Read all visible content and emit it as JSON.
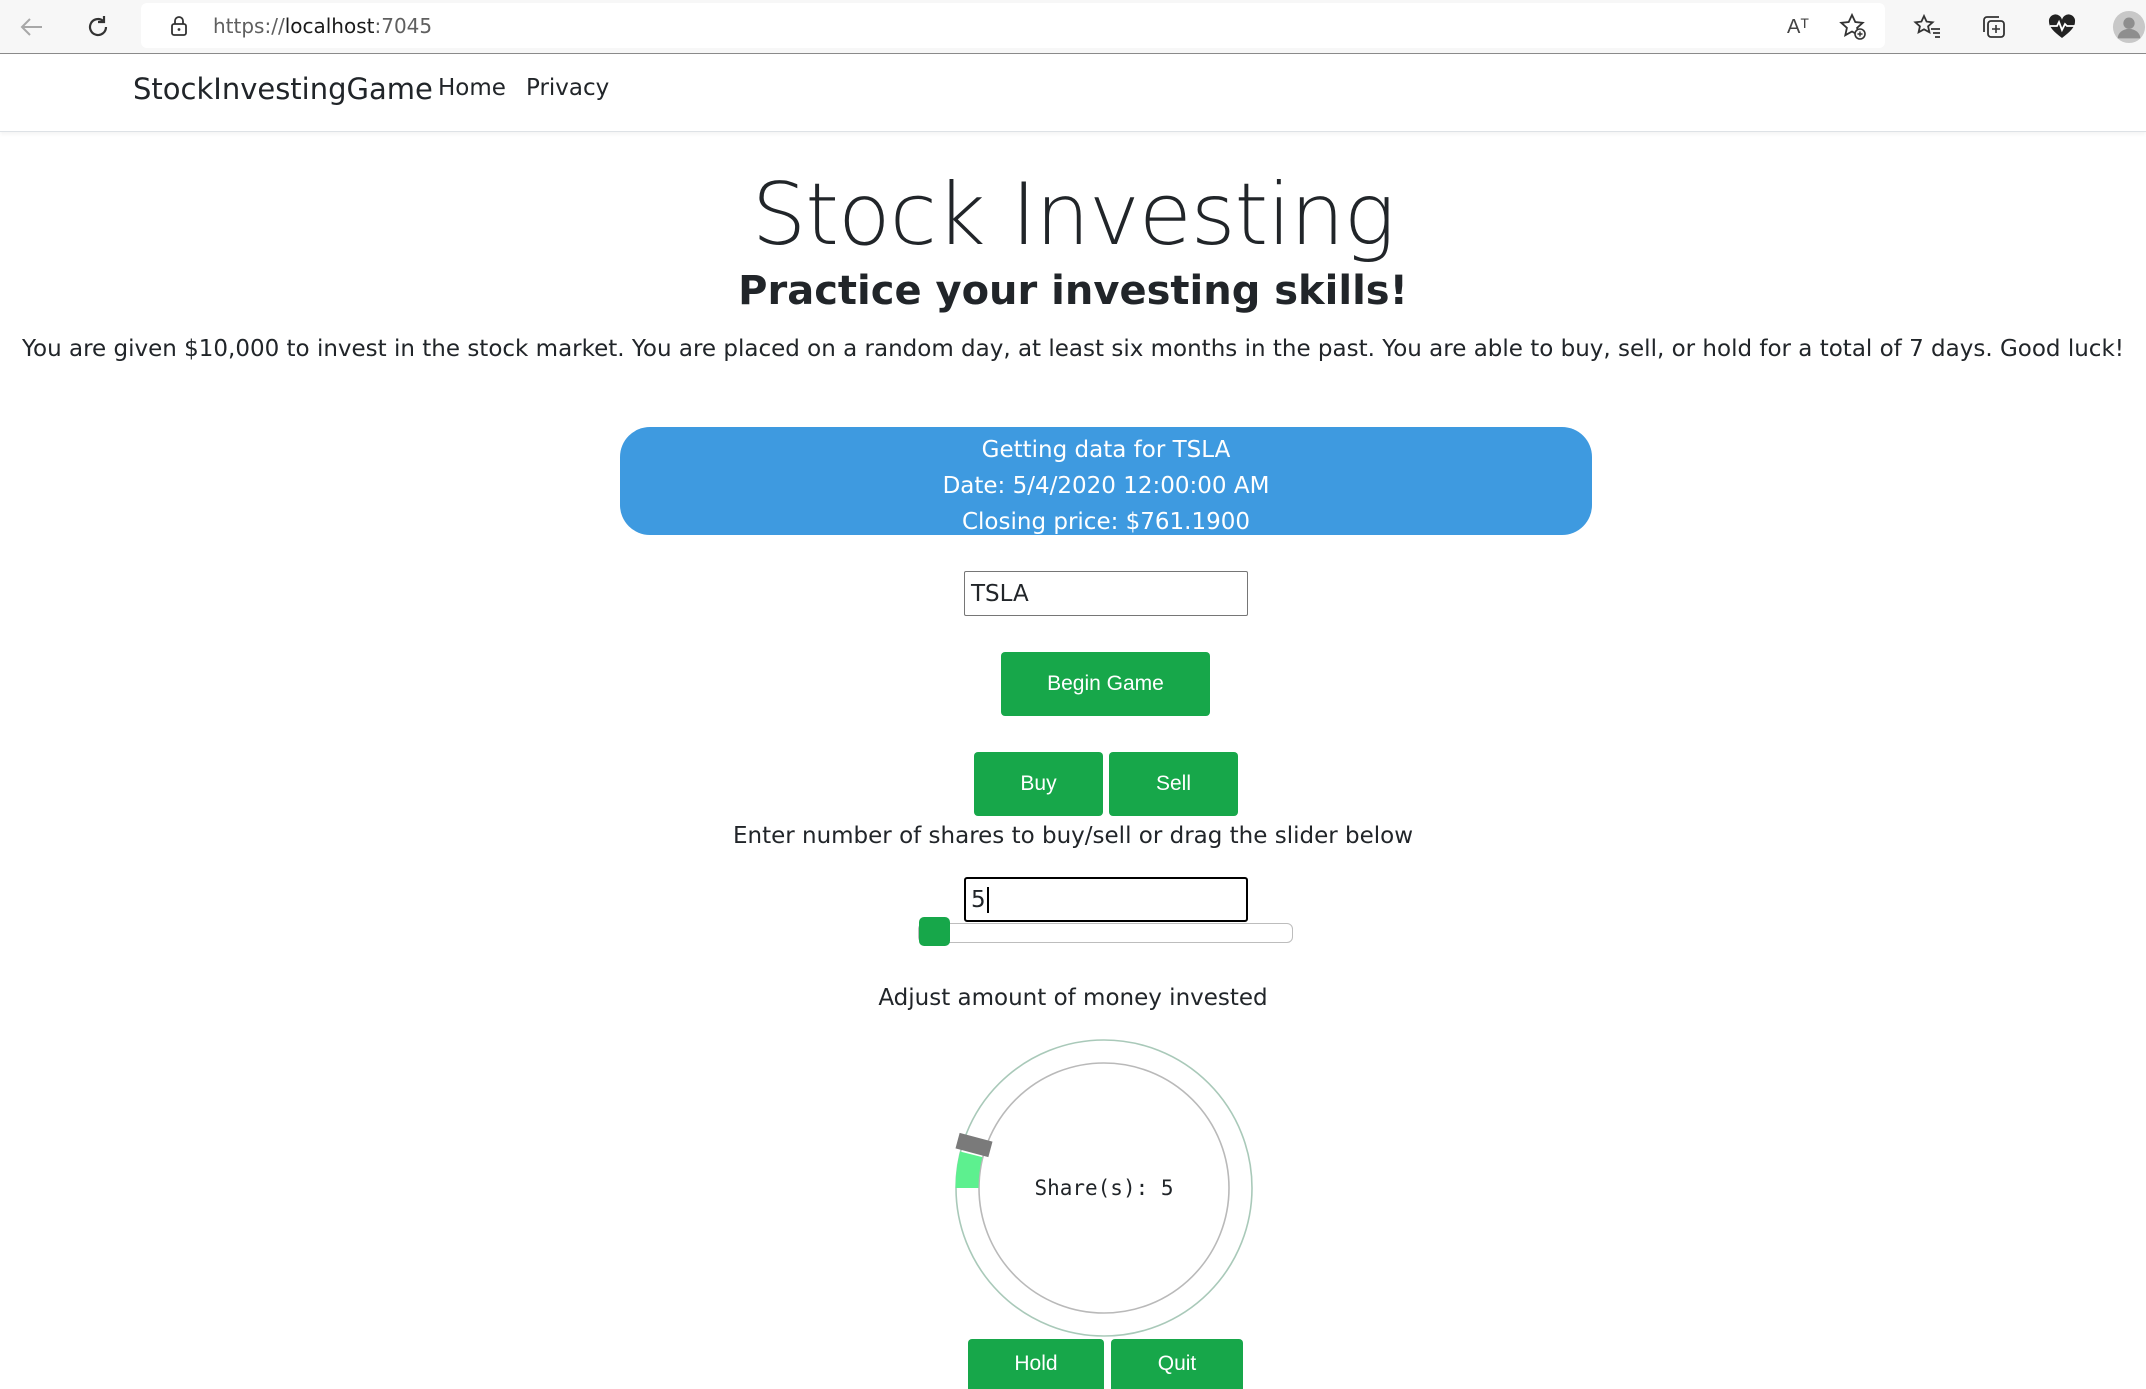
{
  "browser": {
    "url_prefix": "https://",
    "url_host": "localhost",
    "url_port": ":7045",
    "read_aloud_label": "Aᵀ"
  },
  "navbar": {
    "brand": "StockInvestingGame",
    "links": [
      "Home",
      "Privacy"
    ]
  },
  "main": {
    "title": "Stock Investing",
    "subtitle": "Practice your investing skills!",
    "intro": "You are given $10,000 to invest in the stock market. You are placed on a random day, at least six months in the past. You are able to buy, sell, or hold for a total of 7 days. Good luck!"
  },
  "status": {
    "line1": "Getting data for TSLA",
    "line2": "Date: 5/4/2020 12:00:00 AM",
    "line3": "Closing price: $761.1900"
  },
  "ticker_input": {
    "value": "TSLA"
  },
  "buttons": {
    "begin": "Begin Game",
    "buy": "Buy",
    "sell": "Sell",
    "hold": "Hold",
    "quit": "Quit"
  },
  "shares": {
    "instruction": "Enter number of shares to buy/sell or drag the slider below",
    "input_value": "5",
    "slider_fraction": 0.0
  },
  "knob": {
    "label": "Adjust amount of money invested",
    "readout": "Share(s): 5"
  },
  "colors": {
    "accent_green": "#17a74a",
    "info_blue": "#3e9ae0",
    "knob_fill": "#5df08f"
  },
  "icons": [
    "back-arrow-icon",
    "refresh-icon",
    "lock-icon",
    "read-aloud-icon",
    "favorite-add-icon",
    "favorites-icon",
    "collections-icon",
    "health-icon",
    "profile-avatar-icon"
  ]
}
